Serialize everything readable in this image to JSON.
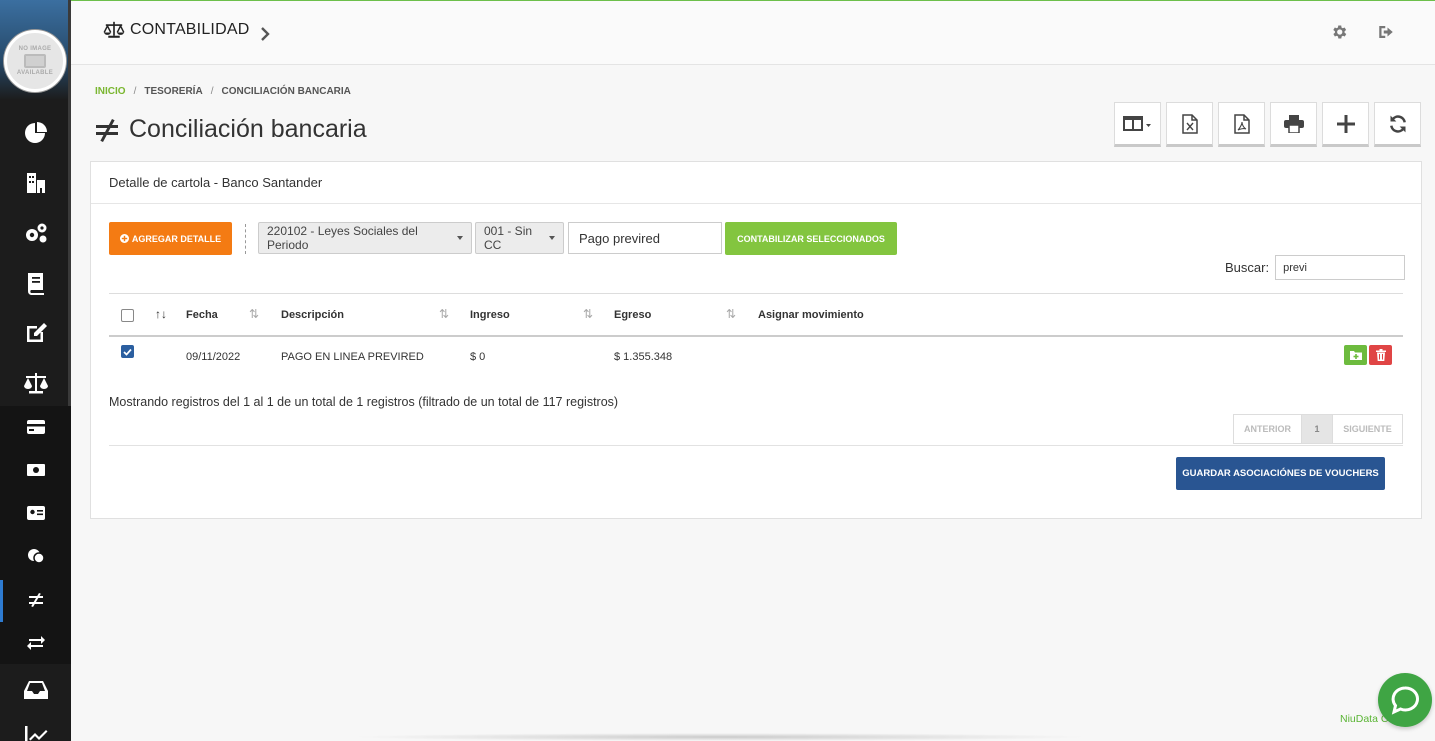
{
  "app": {
    "title": "CONTABILIDAD",
    "avatar_text_top": "NO IMAGE",
    "avatar_text_bottom": "AVAILABLE"
  },
  "breadcrumb": {
    "home": "INICIO",
    "sep": "/",
    "level1": "TESORERÍA",
    "level2": "CONCILIACIÓN BANCARIA"
  },
  "page": {
    "title": "Conciliación bancaria"
  },
  "card": {
    "header": "Detalle de cartola - Banco Santander",
    "add_detail_label": "AGREGAR DETALLE",
    "account_select": "220102 - Leyes Sociales del Periodo",
    "cost_center_select": "001 - Sin CC",
    "description_input": "Pago previred",
    "post_selected_label": "CONTABILIZAR SELECCIONADOS",
    "search_label": "Buscar:",
    "search_value": "previ"
  },
  "table": {
    "columns": [
      "Fecha",
      "Descripción",
      "Ingreso",
      "Egreso",
      "Asignar movimiento"
    ],
    "sort_up_icon": "↑↓",
    "sort_icon": "⇅",
    "rows": [
      {
        "fecha": "09/11/2022",
        "descripcion": "PAGO EN LINEA PREVIRED",
        "ingreso": "$ 0",
        "egreso": "$ 1.355.348",
        "checked": true
      }
    ]
  },
  "summary": {
    "info": "Mostrando registros del 1 al 1 de un total de 1 registros (filtrado de un total de 117 registros)",
    "prev": "ANTERIOR",
    "page": "1",
    "next": "SIGUIENTE",
    "save_label": "GUARDAR ASOCIACIÓNES DE VOUCHERS"
  },
  "footer": {
    "text": "NiuData Cloud"
  },
  "colors": {
    "accent_green": "#83c53f",
    "orange": "#f47b13",
    "blue": "#295592",
    "danger": "#e04545",
    "sidebar": "#1c1c1c"
  }
}
